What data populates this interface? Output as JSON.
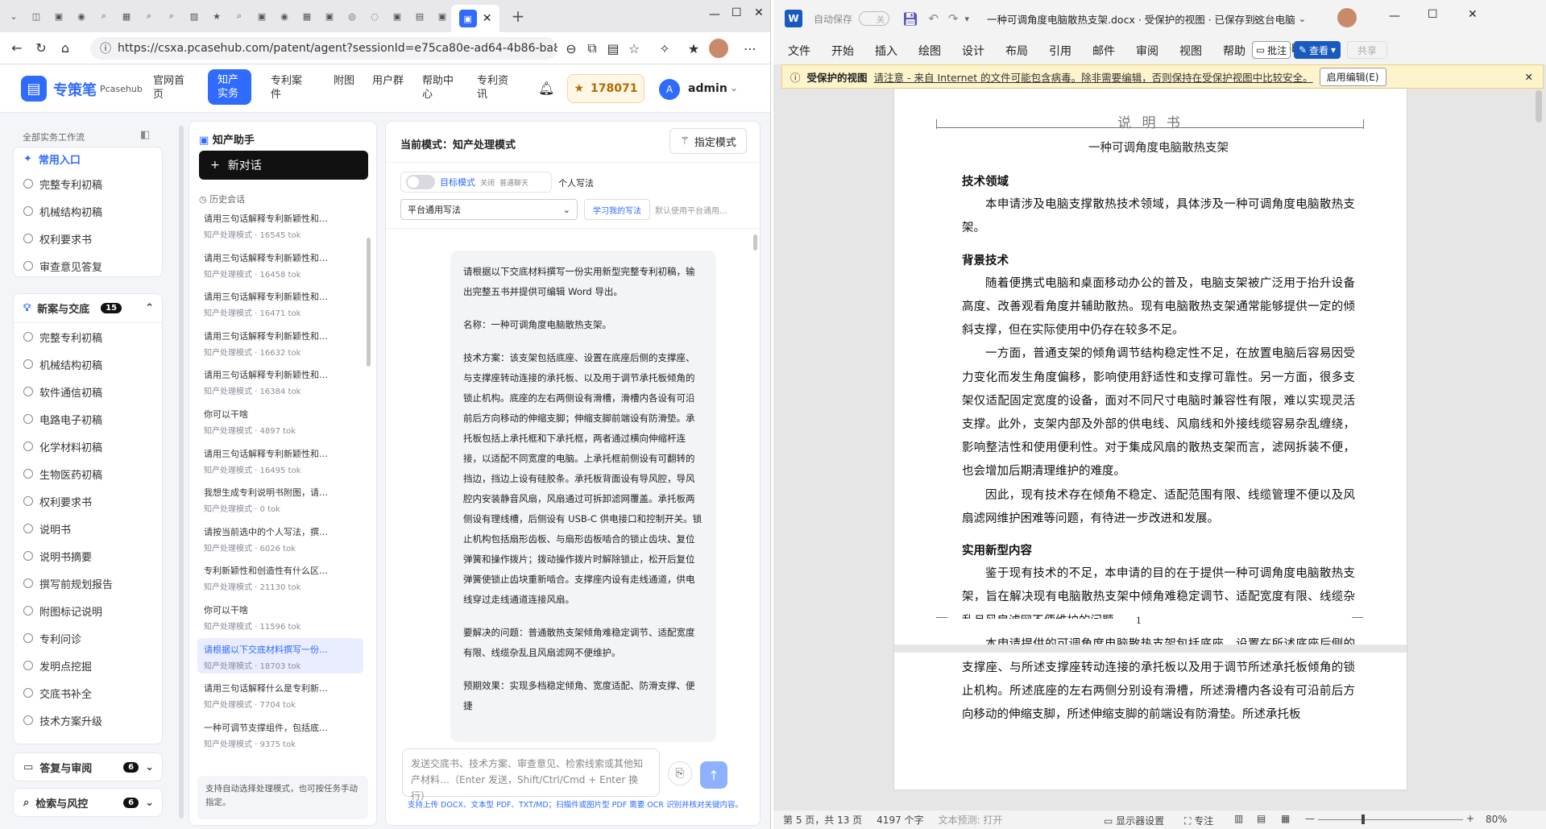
{
  "browser": {
    "url": "https://csxa.pcasehub.com/patent/agent?sessionId=e75ca80e-ad64-4b86-ba87-ab63…",
    "tab_icons": [
      "tab-icon",
      "tab-icon",
      "tab-icon",
      "tab-icon",
      "tab-icon",
      "tab-icon",
      "tab-icon",
      "tab-icon",
      "tab-icon",
      "tab-icon",
      "tab-icon",
      "tab-icon",
      "tab-icon",
      "tab-icon",
      "tab-icon",
      "tab-icon",
      "tab-icon",
      "tab-icon",
      "tab-icon",
      "tab-icon",
      "tab-icon",
      "tab-icon"
    ],
    "new_tab": "+"
  },
  "app": {
    "brand": "专策笔",
    "brand_sub": "Pcasehub",
    "nav": [
      "官网首页",
      "知产实务",
      "专利案件",
      "附图",
      "用户群",
      "帮助中心",
      "专利资讯"
    ],
    "points": "178071",
    "user": "admin",
    "avatar": "A"
  },
  "sidebar": {
    "header": "全部实务工作流",
    "quick_title": "常用入口",
    "quick_items": [
      "完整专利初稿",
      "机械结构初稿",
      "权利要求书",
      "审查意见答复"
    ],
    "group1_title": "新案与交底",
    "group1_count": "15",
    "group1_items": [
      "完整专利初稿",
      "机械结构初稿",
      "软件通信初稿",
      "电路电子初稿",
      "化学材料初稿",
      "生物医药初稿",
      "权利要求书",
      "说明书",
      "说明书摘要",
      "撰写前规划报告",
      "附图标记说明",
      "专利问诊",
      "发明点挖掘",
      "交底书补全",
      "技术方案升级"
    ],
    "group2_title": "答复与审阅",
    "group2_count": "6",
    "group3_title": "检索与风控",
    "group3_count": "6"
  },
  "history": {
    "title": "知产助手",
    "new_chat": "新对话",
    "section": "历史会话",
    "items": [
      {
        "t": "请用三句话解释专利新颖性和…",
        "m": "知产处理模式 · 16545 tok"
      },
      {
        "t": "请用三句话解释专利新颖性和…",
        "m": "知产处理模式 · 16458 tok"
      },
      {
        "t": "请用三句话解释专利新颖性和…",
        "m": "知产处理模式 · 16471 tok"
      },
      {
        "t": "请用三句话解释专利新颖性和…",
        "m": "知产处理模式 · 16632 tok"
      },
      {
        "t": "请用三句话解释专利新颖性和…",
        "m": "知产处理模式 · 16384 tok"
      },
      {
        "t": "你可以干啥",
        "m": "知产处理模式 · 4897 tok"
      },
      {
        "t": "请用三句话解释专利新颖性和…",
        "m": "知产处理模式 · 16495 tok"
      },
      {
        "t": "我想生成专利说明书附图，请…",
        "m": "知产处理模式 · 0 tok"
      },
      {
        "t": "请按当前选中的个人写法，撰…",
        "m": "知产处理模式 · 6026 tok"
      },
      {
        "t": "专利新颖性和创造性有什么区…",
        "m": "知产处理模式 · 21130 tok"
      },
      {
        "t": "你可以干啥",
        "m": "知产处理模式 · 11596 tok"
      },
      {
        "t": "请根据以下交底材料撰写一份…",
        "m": "知产处理模式 · 18703 tok"
      },
      {
        "t": "请用三句话解释什么是专利新…",
        "m": "知产处理模式 · 7704 tok"
      },
      {
        "t": "一种可调节支撑组件，包括底…",
        "m": "知产处理模式 · 9375 tok"
      }
    ],
    "selected_index": 11,
    "footer": "支持自动选择处理模式，也可按任务手动指定。"
  },
  "chat": {
    "mode": "当前模式：知产处理模式",
    "mode_button": "指定模式",
    "toggle_label": "目标模式",
    "toggle_off": "关闭",
    "toggle_hint": "普通聊天",
    "personal": "个人写法",
    "style_select": "平台通用写法",
    "learn_button": "学习我的写法",
    "default_hint": "默认使用平台通用…",
    "message": [
      "请根据以下交底材料撰写一份实用新型完整专利初稿，输出完整五书并提供可编辑 Word 导出。",
      "名称：一种可调角度电脑散热支架。",
      "技术方案：该支架包括底座、设置在底座后侧的支撑座、与支撑座转动连接的承托板、以及用于调节承托板倾角的锁止机构。底座的左右两侧设有滑槽，滑槽内各设有可沿前后方向移动的伸缩支脚；伸缩支脚前端设有防滑垫。承托板包括上承托框和下承托框，两者通过横向伸缩杆连接，以适配不同宽度的电脑。上承托框前侧设有可翻转的挡边，挡边上设有硅胶条。承托板背面设有导风腔，导风腔内安装静音风扇，风扇通过可拆卸滤网覆盖。承托板两侧设有理线槽，后侧设有 USB-C 供电接口和控制开关。锁止机构包括扇形齿板、与扇形齿板啮合的锁止齿块、复位弹簧和操作拨片；拨动操作拨片时解除锁止，松开后复位弹簧使锁止齿块重新啮合。支撑座内设有走线通道，供电线穿过走线通道连接风扇。",
      "要解决的问题：普通散热支架倾角难稳定调节、适配宽度有限、线缆杂乱且风扇滤网不便维护。",
      "预期效果：实现多档稳定倾角、宽度适配、防滑支撑、便捷"
    ],
    "input_placeholder": "发送交底书、技术方案、审查意见、检索线索或其他知产材料…（Enter 发送，Shift/Ctrl/Cmd + Enter 换行）",
    "input_hint": "支持上传 DOCX、文本型 PDF、TXT/MD；扫描件或图片型 PDF 需要 OCR 识别并核对关键内容。"
  },
  "word": {
    "autosave": "自动保存",
    "autosave_state": "关",
    "title": "一种可调角度电脑散热支架.docx · 受保护的视图 · 已保存到这台电脑",
    "menus": [
      "文件",
      "开始",
      "插入",
      "绘图",
      "设计",
      "布局",
      "引用",
      "邮件",
      "审阅",
      "视图",
      "帮助",
      "Acrobat"
    ],
    "comment_btn": "批注",
    "view_btn": "查看",
    "share_btn": "共享",
    "protect_title": "受保护的视图",
    "protect_msg": "请注意 - 来自 Internet 的文件可能包含病毒。除非需要编辑，否则保持在受保护视图中比较安全。",
    "protect_btn": "启用编辑(E)",
    "header": "说 明 书",
    "doc_title": "一种可调角度电脑散热支架",
    "h1": "技术领域",
    "p1": "本申请涉及电脑支撑散热技术领域，具体涉及一种可调角度电脑散热支架。",
    "h2": "背景技术",
    "p2": "随着便携式电脑和桌面移动办公的普及，电脑支架被广泛用于抬升设备高度、改善观看角度并辅助散热。现有电脑散热支架通常能够提供一定的倾斜支撑，但在实际使用中仍存在较多不足。",
    "p3": "一方面，普通支架的倾角调节结构稳定性不足，在放置电脑后容易因受力变化而发生角度偏移，影响使用舒适性和支撑可靠性。另一方面，很多支架仅适配固定宽度的设备，面对不同尺寸电脑时兼容性有限，难以实现灵活支撑。此外，支架内部及外部的供电线、风扇线和外接线缆容易杂乱缠绕，影响整洁性和使用便利性。对于集成风扇的散热支架而言，滤网拆装不便，也会增加后期清理维护的难度。",
    "p4": "因此，现有技术存在倾角不稳定、适配范围有限、线缆管理不便以及风扇滤网维护困难等问题，有待进一步改进和发展。",
    "h3": "实用新型内容",
    "p5": "鉴于现有技术的不足，本申请的目的在于提供一种可调角度电脑散热支架，旨在解决现有电脑散热支架中倾角难稳定调节、适配宽度有限、线缆杂乱且风扇滤网不便维护的问题。",
    "p6": "本申请提供的可调角度电脑散热支架包括底座、设置在所述底座后侧的支撑座、与所述支撑座转动连接的承托板以及用于调节所述承托板倾角的锁止机构。所述底座的左右两侧分别设有滑槽，所述滑槽内各设有可沿前后方向移动的伸缩支脚，所述伸缩支脚的前端设有防滑垫。所述承托板",
    "page_num": "1",
    "status_page": "第 5 页，共 13 页",
    "status_words": "4197 个字",
    "status_predict": "文本预测: 打开",
    "status_display": "显示器设置",
    "status_focus": "专注",
    "zoom": "80%"
  }
}
